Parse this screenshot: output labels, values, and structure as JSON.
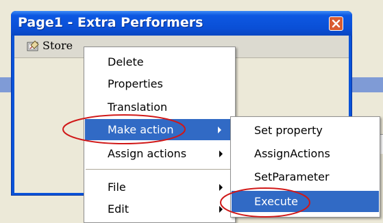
{
  "window": {
    "title": "Page1 - Extra Performers",
    "store_label": "Store"
  },
  "context_menu": {
    "items": [
      {
        "label": "Delete"
      },
      {
        "label": "Properties"
      },
      {
        "label": "Translation"
      },
      {
        "label": "Make action",
        "submenu": true,
        "selected": true
      },
      {
        "label": "Assign actions",
        "submenu": true
      },
      {
        "label": "File",
        "submenu": true
      },
      {
        "label": "Edit",
        "submenu": true
      }
    ]
  },
  "submenu": {
    "items": [
      {
        "label": "Set property"
      },
      {
        "label": "AssignActions"
      },
      {
        "label": "SetParameter"
      },
      {
        "label": "Execute",
        "selected": true
      }
    ]
  },
  "colors": {
    "titlebar": "#0a4fd6",
    "highlight": "#316ac5",
    "annotation": "#d01818"
  },
  "icons": [
    "close-icon",
    "store-icon",
    "submenu-arrow-icon"
  ]
}
